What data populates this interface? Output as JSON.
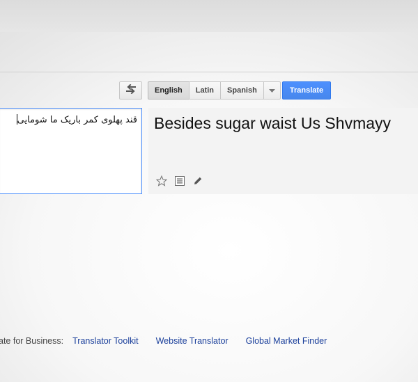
{
  "toolbar": {
    "languages": [
      "English",
      "Latin",
      "Spanish"
    ],
    "translate_label": "Translate"
  },
  "source": {
    "text": "قند پهلوی کمر باریک ما شومایی"
  },
  "result": {
    "text": "Besides sugar waist Us Shvmayy"
  },
  "footer": {
    "label": "ate for Business:",
    "links": [
      "Translator Toolkit",
      "Website Translator",
      "Global Market Finder"
    ]
  },
  "colors": {
    "accent": "#4d90fe",
    "link": "#1a3f9b"
  },
  "icons": [
    "swap-languages-icon",
    "chevron-down-icon",
    "star-icon",
    "list-icon",
    "pencil-icon"
  ]
}
